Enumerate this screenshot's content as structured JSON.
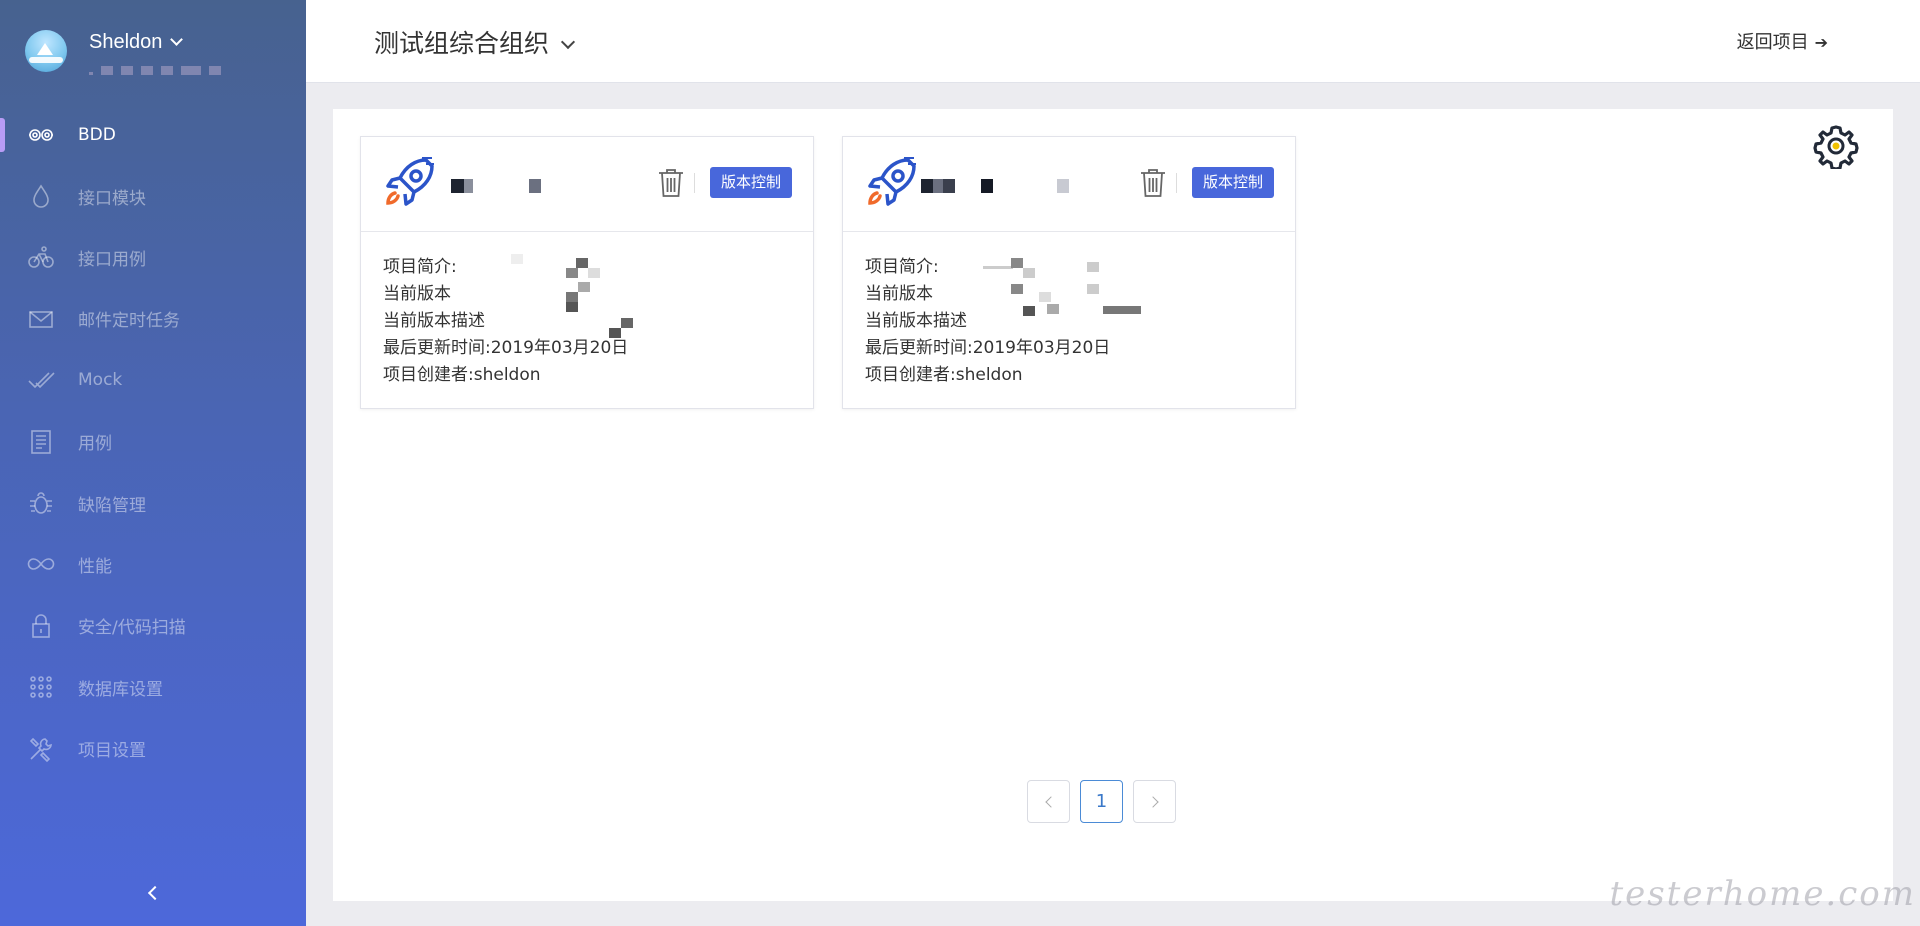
{
  "user": {
    "name": "Sheldon"
  },
  "nav": [
    {
      "label": "BDD",
      "icon": "bdd-icon",
      "active": true
    },
    {
      "label": "接口模块",
      "icon": "drop-icon"
    },
    {
      "label": "接口用例",
      "icon": "bike-icon"
    },
    {
      "label": "邮件定时任务",
      "icon": "mail-icon"
    },
    {
      "label": "Mock",
      "icon": "double-check-icon"
    },
    {
      "label": "用例",
      "icon": "document-icon"
    },
    {
      "label": "缺陷管理",
      "icon": "bug-icon"
    },
    {
      "label": "性能",
      "icon": "infinity-icon"
    },
    {
      "label": "安全/代码扫描",
      "icon": "lock-icon"
    },
    {
      "label": "数据库设置",
      "icon": "grid-icon"
    },
    {
      "label": "项目设置",
      "icon": "tools-icon"
    }
  ],
  "topbar": {
    "org_title": "测试组综合组织",
    "back_label": "返回项目"
  },
  "cards": [
    {
      "version_button": "版本控制",
      "intro_label": "项目简介:",
      "version_label": "当前版本",
      "version_desc_label": "当前版本描述",
      "updated_label": "最后更新时间:",
      "updated_value": "2019年03月20日",
      "creator_label": "项目创建者:",
      "creator_value": "sheldon"
    },
    {
      "version_button": "版本控制",
      "intro_label": "项目简介:",
      "version_label": "当前版本",
      "version_desc_label": "当前版本描述",
      "updated_label": "最后更新时间:",
      "updated_value": "2019年03月20日",
      "creator_label": "项目创建者:",
      "creator_value": "sheldon"
    }
  ],
  "pagination": {
    "current": "1"
  },
  "watermark": "testerhome.com",
  "colors": {
    "accent": "#4867db",
    "sidebar_top": "#47628f",
    "sidebar_bottom": "#4d68da",
    "rocket": "#2b54c9",
    "flame": "#f06a2b"
  }
}
